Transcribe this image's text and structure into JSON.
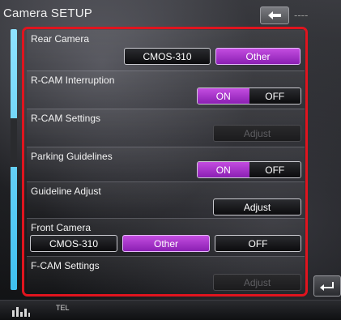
{
  "header": {
    "title": "Camera SETUP",
    "status_dashes": "----"
  },
  "sections": {
    "rear_camera": {
      "label": "Rear Camera",
      "opt1": "CMOS-310",
      "opt2": "Other",
      "selected": "Other"
    },
    "rcam_interruption": {
      "label": "R-CAM Interruption",
      "on": "ON",
      "off": "OFF",
      "value": "ON"
    },
    "rcam_settings": {
      "label": "R-CAM Settings",
      "adjust": "Adjust"
    },
    "parking_guidelines": {
      "label": "Parking Guidelines",
      "on": "ON",
      "off": "OFF",
      "value": "ON"
    },
    "guideline_adjust": {
      "label": "Guideline Adjust",
      "adjust": "Adjust"
    },
    "front_camera": {
      "label": "Front Camera",
      "opt1": "CMOS-310",
      "opt2": "Other",
      "opt3": "OFF",
      "selected": "Other"
    },
    "fcam_settings": {
      "label": "F-CAM Settings",
      "adjust": "Adjust"
    }
  },
  "bottom": {
    "tel_label": "TEL"
  },
  "colors": {
    "accent_selected": "#a933cc",
    "highlight_frame": "#e0141e",
    "scroll_bar": "#3fc0f0"
  },
  "icons": [
    "back-arrow-icon",
    "return-arrow-icon",
    "equalizer-icon"
  ]
}
